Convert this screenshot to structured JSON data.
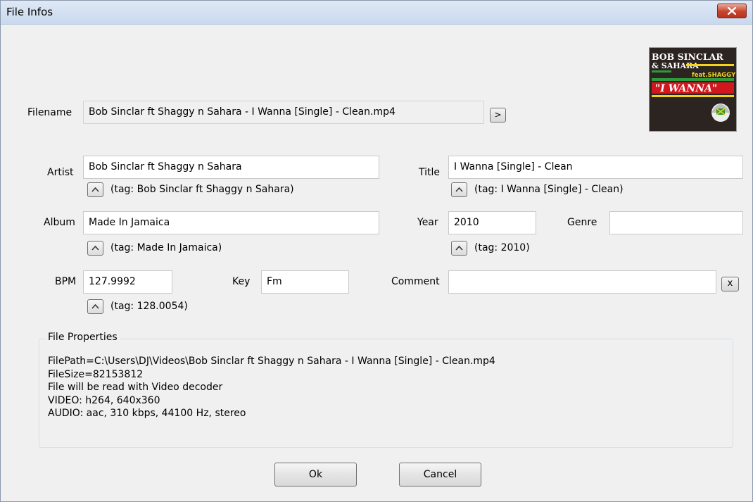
{
  "window": {
    "title": "File Infos"
  },
  "filename": {
    "label": "Filename",
    "value": "Bob Sinclar ft Shaggy n Sahara - I Wanna [Single] - Clean.mp4",
    "browse_label": ">"
  },
  "artist": {
    "label": "Artist",
    "value": "Bob Sinclar ft Shaggy n Sahara",
    "tag": "(tag: Bob Sinclar ft Shaggy n Sahara)"
  },
  "title_field": {
    "label": "Title",
    "value": "I Wanna [Single] - Clean",
    "tag": "(tag: I Wanna [Single] - Clean)"
  },
  "album": {
    "label": "Album",
    "value": "Made In Jamaica",
    "tag": "(tag: Made In Jamaica)"
  },
  "year": {
    "label": "Year",
    "value": "2010",
    "tag": "(tag: 2010)"
  },
  "genre": {
    "label": "Genre",
    "value": ""
  },
  "bpm": {
    "label": "BPM",
    "value": "127.9992",
    "tag": "(tag: 128.0054)"
  },
  "key": {
    "label": "Key",
    "value": "Fm"
  },
  "comment": {
    "label": "Comment",
    "value": "",
    "clear_label": "x"
  },
  "properties": {
    "title": "File Properties",
    "lines": [
      "FilePath=C:\\Users\\DJ\\Videos\\Bob Sinclar ft Shaggy n Sahara - I Wanna [Single] - Clean.mp4",
      "FileSize=82153812",
      "File will be read with Video decoder",
      "VIDEO: h264, 640x360",
      "AUDIO: aac, 310 kbps, 44100 Hz, stereo"
    ]
  },
  "cover": {
    "line1": "BOB SINCLAR",
    "line2": "& SAHARA",
    "line3": "feat.SHAGGY",
    "line4": "\"I WANNA\""
  },
  "buttons": {
    "ok": "Ok",
    "cancel": "Cancel"
  },
  "icons": {
    "close": "close-icon",
    "up": "up-arrow-icon"
  },
  "colors": {
    "close_red": "#c7432d",
    "titlebar": "#dfe9f5",
    "cover_yellow": "#f2d21b",
    "cover_red": "#d1161c",
    "cover_green": "#2c9a3d"
  }
}
